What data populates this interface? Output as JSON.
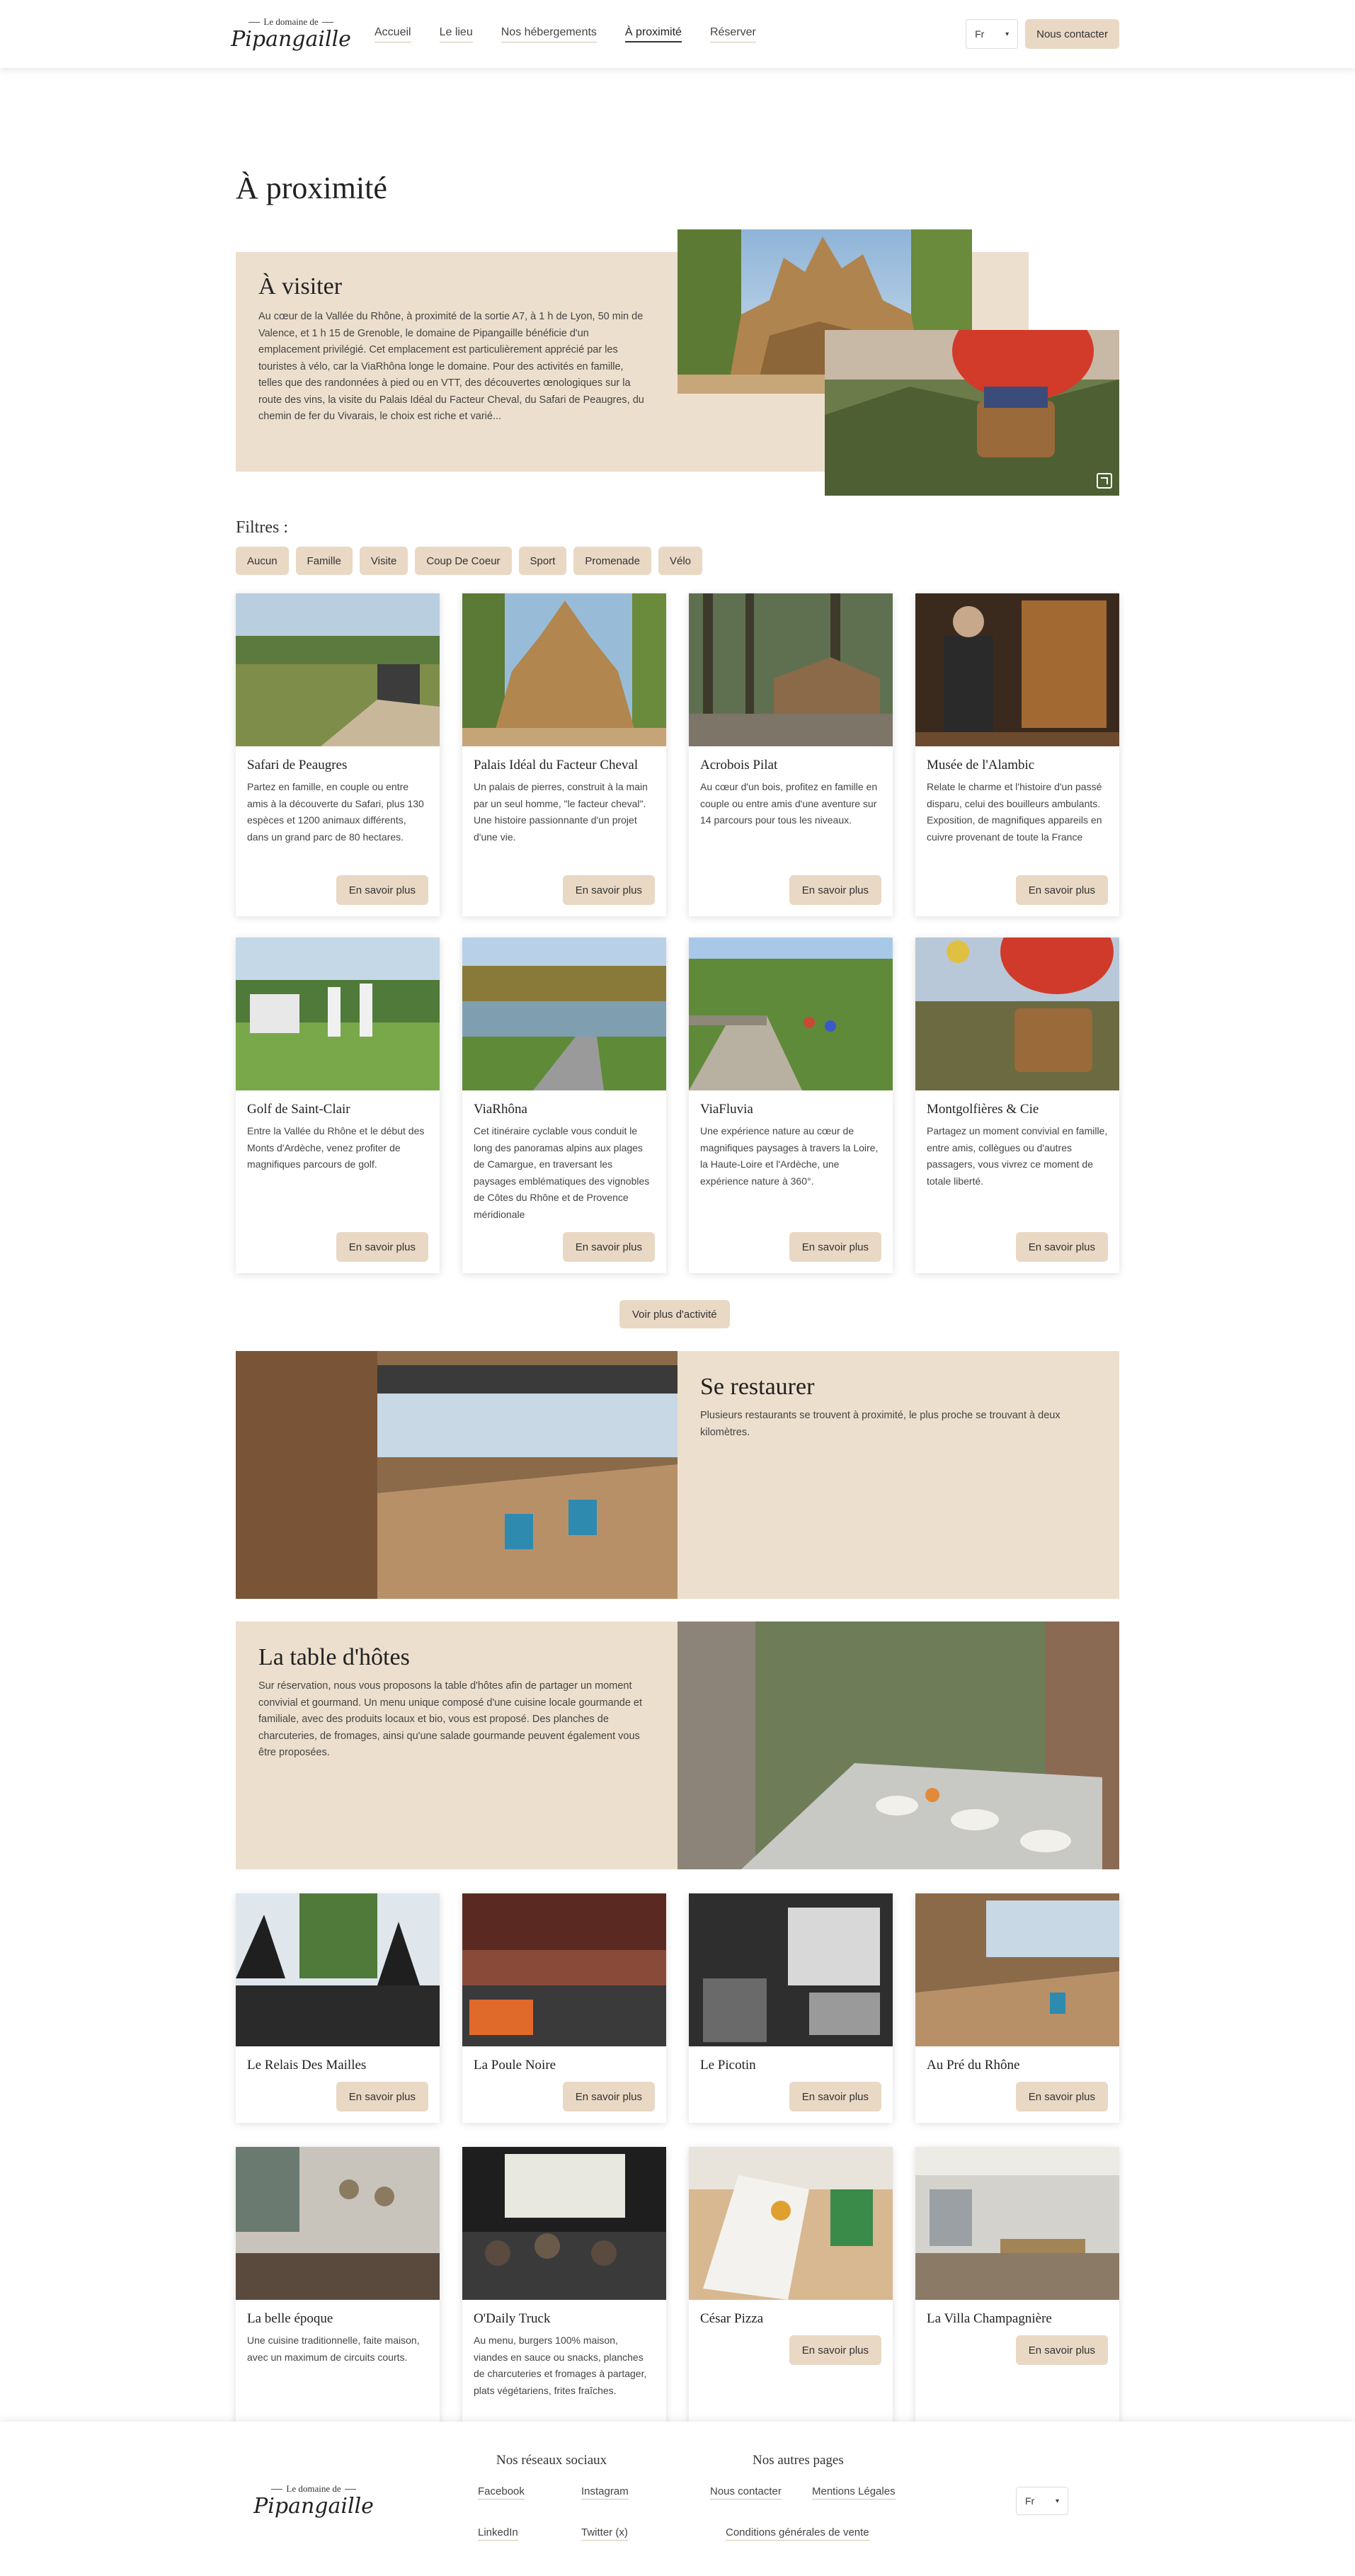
{
  "header": {
    "logo_top": "Le domaine de",
    "logo_name": "Pipangaille",
    "nav": [
      "Accueil",
      "Le lieu",
      "Nos hébergements",
      "À proximité",
      "Réserver"
    ],
    "lang": "Fr",
    "contact": "Nous contacter"
  },
  "page_title": "À proximité",
  "visit": {
    "title": "À visiter",
    "text": "Au cœur de la Vallée du Rhône, à proximité de la sortie A7, à 1 h de Lyon, 50 min de Valence, et 1 h 15 de Grenoble, le domaine de Pipangaille bénéficie d'un emplacement privilégié. Cet emplacement est particulièrement apprécié par les touristes à vélo, car la ViaRhôna longe le domaine. Pour des activités en famille, telles que des randonnées à pied ou en VTT, des découvertes œnologiques sur la route des vins, la visite du Palais Idéal du Facteur Cheval, du Safari de Peaugres, du chemin de fer du Vivarais, le choix est riche et varié..."
  },
  "filters": {
    "label": "Filtres :",
    "items": [
      "Aucun",
      "Famille",
      "Visite",
      "Coup De Coeur",
      "Sport",
      "Promenade",
      "Vélo"
    ]
  },
  "more_label": "En savoir plus",
  "activities": [
    {
      "title": "Safari de Peaugres",
      "text": "Partez en famille, en couple ou entre amis à la découverte du Safari, plus 130 espèces et 1200 animaux différents, dans un grand parc de 80 hectares."
    },
    {
      "title": "Palais Idéal du Facteur Cheval",
      "text": "Un palais de pierres, construit à la main par un seul homme, \"le facteur cheval\". Une histoire passionnante d'un projet d'une vie."
    },
    {
      "title": "Acrobois Pilat",
      "text": "Au cœur d'un bois, profitez en famille en couple ou entre amis d'une aventure sur 14 parcours pour tous les niveaux."
    },
    {
      "title": "Musée de l'Alambic",
      "text": "Relate le charme et l'histoire d'un passé disparu, celui des bouilleurs ambulants. Exposition, de magnifiques appareils en cuivre provenant de toute la France"
    },
    {
      "title": "Golf de Saint-Clair",
      "text": "Entre la Vallée du Rhône et le début des Monts d'Ardèche, venez profiter de magnifiques parcours de golf."
    },
    {
      "title": "ViaRhôna",
      "text": "Cet itinéraire cyclable vous conduit le long des panoramas alpins aux plages de Camargue, en traversant les paysages emblématiques des vignobles de Côtes du Rhône et de Provence méridionale"
    },
    {
      "title": "ViaFluvia",
      "text": "Une expérience nature au cœur de magnifiques paysages à travers la Loire, la Haute-Loire et l'Ardèche, une expérience nature à 360°."
    },
    {
      "title": "Montgolfières & Cie",
      "text": "Partagez un moment convivial en famille, entre amis, collègues ou d'autres passagers, vous vivrez ce moment de totale liberté."
    }
  ],
  "see_more": "Voir plus d'activité",
  "restaurants_section": {
    "title": "Se restaurer",
    "text": "Plusieurs restaurants se trouvent à proximité, le plus proche se trouvant à deux kilomètres."
  },
  "table_hotes": {
    "title": "La table d'hôtes",
    "text": "Sur réservation, nous vous proposons la table d'hôtes afin de partager un moment convivial et gourmand. Un menu unique composé d'une cuisine locale gourmande et familiale, avec des produits locaux et bio, vous est proposé. Des planches de charcuteries, de fromages, ainsi qu'une salade gourmande peuvent également vous être proposées."
  },
  "restaurants": [
    {
      "title": "Le Relais Des Mailles",
      "text": ""
    },
    {
      "title": "La Poule Noire",
      "text": ""
    },
    {
      "title": "Le Picotin",
      "text": ""
    },
    {
      "title": "Au Pré du Rhône",
      "text": ""
    },
    {
      "title": "La belle époque",
      "text": "Une cuisine traditionnelle, faite maison, avec un maximum de circuits courts."
    },
    {
      "title": "O'Daily Truck",
      "text": "Au menu, burgers 100% maison, viandes en sauce ou snacks, planches de charcuteries et fromages à partager, plats végétariens, frites fraîches."
    },
    {
      "title": "César Pizza",
      "text": ""
    },
    {
      "title": "La Villa Champagnière",
      "text": ""
    }
  ],
  "footer": {
    "social_title": "Nos réseaux sociaux",
    "pages_title": "Nos autres pages",
    "facebook": "Facebook",
    "instagram": "Instagram",
    "linkedin": "LinkedIn",
    "twitter": "Twitter (x)",
    "contact": "Nous contacter",
    "legal": "Mentions Légales",
    "cgv": "Conditions générales de vente",
    "lang": "Fr"
  }
}
